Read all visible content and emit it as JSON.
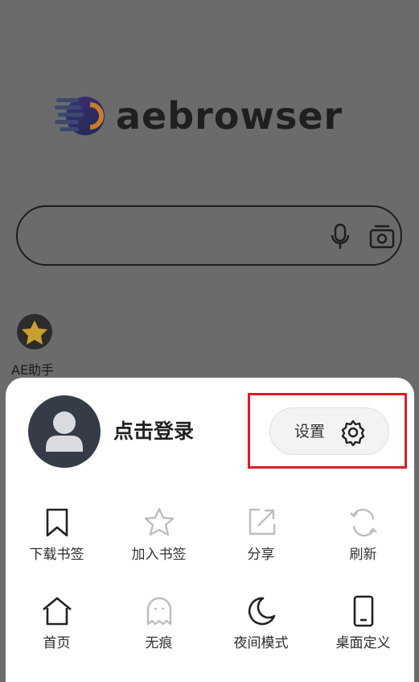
{
  "home": {
    "logo_text": "aebrowser",
    "shortcut_label": "AE助手"
  },
  "menu": {
    "login_label": "点击登录",
    "settings_label": "设置",
    "row1": [
      {
        "label": "下载书签",
        "icon": "bookmark-icon"
      },
      {
        "label": "加入书签",
        "icon": "star-icon"
      },
      {
        "label": "分享",
        "icon": "share-icon"
      },
      {
        "label": "刷新",
        "icon": "refresh-icon"
      }
    ],
    "row2": [
      {
        "label": "首页",
        "icon": "home-icon"
      },
      {
        "label": "无痕",
        "icon": "ghost-icon"
      },
      {
        "label": "夜间模式",
        "icon": "moon-icon"
      },
      {
        "label": "桌面定义",
        "icon": "phone-icon"
      }
    ]
  },
  "colors": {
    "overlay": "#6b6b6b",
    "highlight": "#e01b24",
    "logo_purple": "#5b3fa6"
  }
}
